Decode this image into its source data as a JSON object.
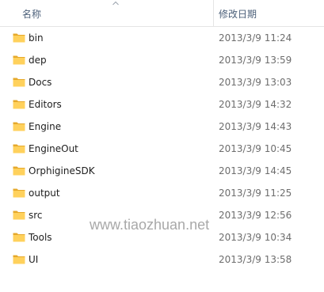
{
  "header": {
    "name_label": "名称",
    "date_label": "修改日期",
    "sort_icon": "sort-up-icon"
  },
  "files": [
    {
      "name": "bin",
      "date": "2013/3/9 11:24",
      "icon": "folder-icon"
    },
    {
      "name": "dep",
      "date": "2013/3/9 13:59",
      "icon": "folder-icon"
    },
    {
      "name": "Docs",
      "date": "2013/3/9 13:03",
      "icon": "folder-icon"
    },
    {
      "name": "Editors",
      "date": "2013/3/9 14:32",
      "icon": "folder-icon"
    },
    {
      "name": "Engine",
      "date": "2013/3/9 14:43",
      "icon": "folder-icon"
    },
    {
      "name": "EngineOut",
      "date": "2013/3/9 10:45",
      "icon": "folder-icon"
    },
    {
      "name": "OrphigineSDK",
      "date": "2013/3/9 14:45",
      "icon": "folder-icon"
    },
    {
      "name": "output",
      "date": "2013/3/9 11:25",
      "icon": "folder-icon"
    },
    {
      "name": "src",
      "date": "2013/3/9 12:56",
      "icon": "folder-icon"
    },
    {
      "name": "Tools",
      "date": "2013/3/9 10:34",
      "icon": "folder-icon"
    },
    {
      "name": "UI",
      "date": "2013/3/9 13:58",
      "icon": "folder-icon"
    }
  ],
  "watermark": "www.tiaozhuan.net",
  "colors": {
    "folder_body": "#ffd15c",
    "folder_tab": "#e6a92b",
    "header_text": "#4c607a",
    "date_text": "#6d6d6d"
  }
}
